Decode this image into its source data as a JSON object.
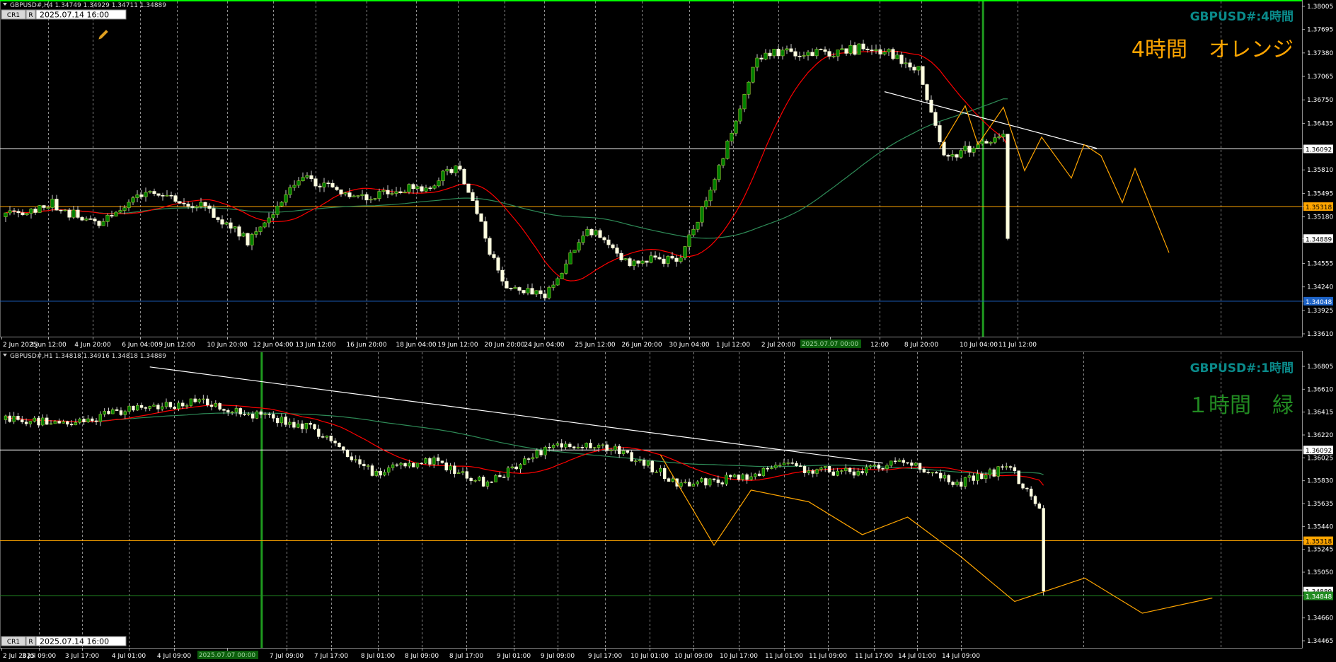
{
  "colors": {
    "bull": "#008000",
    "bear": "#ffffe0",
    "wick": "#c8c8c8",
    "ma_fast": "#ff0000",
    "ma_slow": "#2e8b57",
    "zigzag": "#ffa500",
    "trend": "#ffffff",
    "grid": "#8a8a8a",
    "axis_text": "#ffffff",
    "accent_teal": "#0a8a8a",
    "orange": "#ffa500",
    "green": "#228b22",
    "blue": "#1e64c8",
    "frame_top": "#00ff00",
    "marker_line": "#1f9a1f"
  },
  "chart_data": [
    {
      "id": "h4",
      "type": "candlestick",
      "header": "GBPUSD#,H4  1.34749 1.34929 1.34711 1.34889",
      "symbol_title": "GBPUSD#:4時間",
      "label_big": "4時間　オレンジ",
      "date_box": "2025.07.14 16:00",
      "box_cr": "CR1",
      "box_r": "R",
      "x_ticks": [
        "2 Jun 2025",
        "3 Jun 12:00",
        "4 Jun 20:00",
        "6 Jun 04:00",
        "9 Jun 12:00",
        "10 Jun 20:00",
        "12 Jun 04:00",
        "13 Jun 12:00",
        "16 Jun 20:00",
        "18 Jun 04:00",
        "19 Jun 12:00",
        "20 Jun 20:00",
        "24 Jun 04:00",
        "25 Jun 12:00",
        "26 Jun 20:00",
        "30 Jun 04:00",
        "1 Jul 12:00",
        "2 Jul 20:00",
        "2025.07.07 00:00",
        "12:00",
        "8 Jul 20:00",
        "10 Jul 04:00",
        "11 Jul 12:00"
      ],
      "y_ticks": [
        "1.38005",
        "1.37695",
        "1.37380",
        "1.37065",
        "1.36750",
        "1.36435",
        "1.36092",
        "1.35810",
        "1.35495",
        "1.35318",
        "1.35180",
        "1.34889",
        "1.34555",
        "1.34240",
        "1.34048",
        "1.33925",
        "1.33610"
      ],
      "ylim": [
        1.3361,
        1.38005
      ],
      "n_bars": 237,
      "hlines": [
        {
          "price": 1.36092,
          "label": "1.36092",
          "color": "#ffffff"
        },
        {
          "price": 1.35318,
          "label": "1.35318",
          "color": "#ffa500"
        },
        {
          "price": 1.34048,
          "label": "1.34048",
          "color": "#1e64c8"
        }
      ],
      "current_price": {
        "price": 1.34889,
        "label": "1.34889"
      },
      "vline_frac": 0.755,
      "waypoints": [
        [
          0,
          1.3518
        ],
        [
          12,
          1.3535
        ],
        [
          22,
          1.3508
        ],
        [
          35,
          1.3555
        ],
        [
          48,
          1.353
        ],
        [
          58,
          1.3485
        ],
        [
          70,
          1.357
        ],
        [
          85,
          1.3545
        ],
        [
          100,
          1.356
        ],
        [
          108,
          1.3585
        ],
        [
          118,
          1.3425
        ],
        [
          128,
          1.341
        ],
        [
          138,
          1.3505
        ],
        [
          148,
          1.3455
        ],
        [
          160,
          1.3465
        ],
        [
          168,
          1.3565
        ],
        [
          178,
          1.3735
        ],
        [
          195,
          1.374
        ],
        [
          206,
          1.3745
        ],
        [
          216,
          1.3715
        ],
        [
          222,
          1.36
        ],
        [
          232,
          1.3615
        ],
        [
          245,
          1.3665
        ],
        [
          256,
          1.3615
        ],
        [
          265,
          1.356
        ],
        [
          275,
          1.3565
        ],
        [
          290,
          1.355
        ],
        [
          300,
          1.351
        ],
        [
          310,
          1.3475
        ]
      ],
      "trendline": [
        [
          207,
          1.3686
        ],
        [
          257,
          1.361
        ]
      ],
      "zigzag": [
        [
          220,
          1.361
        ],
        [
          226,
          1.3667
        ],
        [
          229,
          1.3615
        ],
        [
          235,
          1.3665
        ],
        [
          240,
          1.358
        ],
        [
          244,
          1.3625
        ],
        [
          251,
          1.357
        ],
        [
          254,
          1.3615
        ],
        [
          258,
          1.36
        ],
        [
          263,
          1.3537
        ],
        [
          266,
          1.3583
        ],
        [
          274,
          1.347
        ]
      ]
    },
    {
      "id": "h1",
      "type": "candlestick",
      "header": "GBPUSD#,H1  1.34818 1.34916 1.34818 1.34889",
      "symbol_title": "GBPUSD#:1時間",
      "label_big": "１時間　緑",
      "date_box": "2025.07.14 16:00",
      "box_cr": "CR1",
      "box_r": "R",
      "x_ticks": [
        "2 Jul 2025",
        "3 Jul 09:00",
        "3 Jul 17:00",
        "4 Jul 01:00",
        "4 Jul 09:00",
        "2025.07.07 00:00",
        "7 Jul 09:00",
        "7 Jul 17:00",
        "8 Jul 01:00",
        "8 Jul 09:00",
        "8 Jul 17:00",
        "9 Jul 01:00",
        "9 Jul 09:00",
        "9 Jul 17:00",
        "10 Jul 01:00",
        "10 Jul 09:00",
        "10 Jul 17:00",
        "11 Jul 01:00",
        "11 Jul 09:00",
        "11 Jul 17:00",
        "14 Jul 01:00",
        "14 Jul 09:00"
      ],
      "y_ticks": [
        "1.36805",
        "1.36610",
        "1.36415",
        "1.36220",
        "1.36092",
        "1.36025",
        "1.35830",
        "1.35635",
        "1.35440",
        "1.35318",
        "1.35245",
        "1.35050",
        "1.34889",
        "1.34848",
        "1.34660",
        "1.34465"
      ],
      "ylim": [
        1.34465,
        1.36805
      ],
      "n_bars": 253,
      "hlines": [
        {
          "price": 1.36092,
          "label": "1.36092",
          "color": "#ffffff"
        },
        {
          "price": 1.35318,
          "label": "1.35318",
          "color": "#ffa500"
        },
        {
          "price": 1.34848,
          "label": "1.34848",
          "color": "#228b22"
        }
      ],
      "current_price": {
        "price": 1.34889,
        "label": "1.34889"
      },
      "vline_frac": 0.201,
      "waypoints": [
        [
          0,
          1.3635
        ],
        [
          18,
          1.3633
        ],
        [
          33,
          1.3645
        ],
        [
          48,
          1.365
        ],
        [
          60,
          1.364
        ],
        [
          74,
          1.363
        ],
        [
          90,
          1.359
        ],
        [
          105,
          1.36
        ],
        [
          118,
          1.358
        ],
        [
          132,
          1.361
        ],
        [
          145,
          1.3615
        ],
        [
          155,
          1.36
        ],
        [
          165,
          1.358
        ],
        [
          178,
          1.3585
        ],
        [
          190,
          1.3595
        ],
        [
          205,
          1.359
        ],
        [
          220,
          1.36
        ],
        [
          232,
          1.358
        ],
        [
          245,
          1.3595
        ],
        [
          255,
          1.354
        ],
        [
          265,
          1.357
        ],
        [
          278,
          1.356
        ],
        [
          292,
          1.352
        ],
        [
          305,
          1.3515
        ],
        [
          318,
          1.349
        ],
        [
          330,
          1.347
        ],
        [
          340,
          1.349
        ],
        [
          346,
          1.3488
        ]
      ],
      "trendline": [
        [
          35,
          1.368
        ],
        [
          213,
          1.3598
        ]
      ],
      "zigzag": [
        [
          159,
          1.3605
        ],
        [
          172,
          1.3528
        ],
        [
          181,
          1.3575
        ],
        [
          195,
          1.3565
        ],
        [
          208,
          1.3537
        ],
        [
          219,
          1.3552
        ],
        [
          232,
          1.3518
        ],
        [
          245,
          1.348
        ],
        [
          262,
          1.35
        ],
        [
          276,
          1.347
        ],
        [
          293,
          1.3483
        ]
      ]
    }
  ]
}
